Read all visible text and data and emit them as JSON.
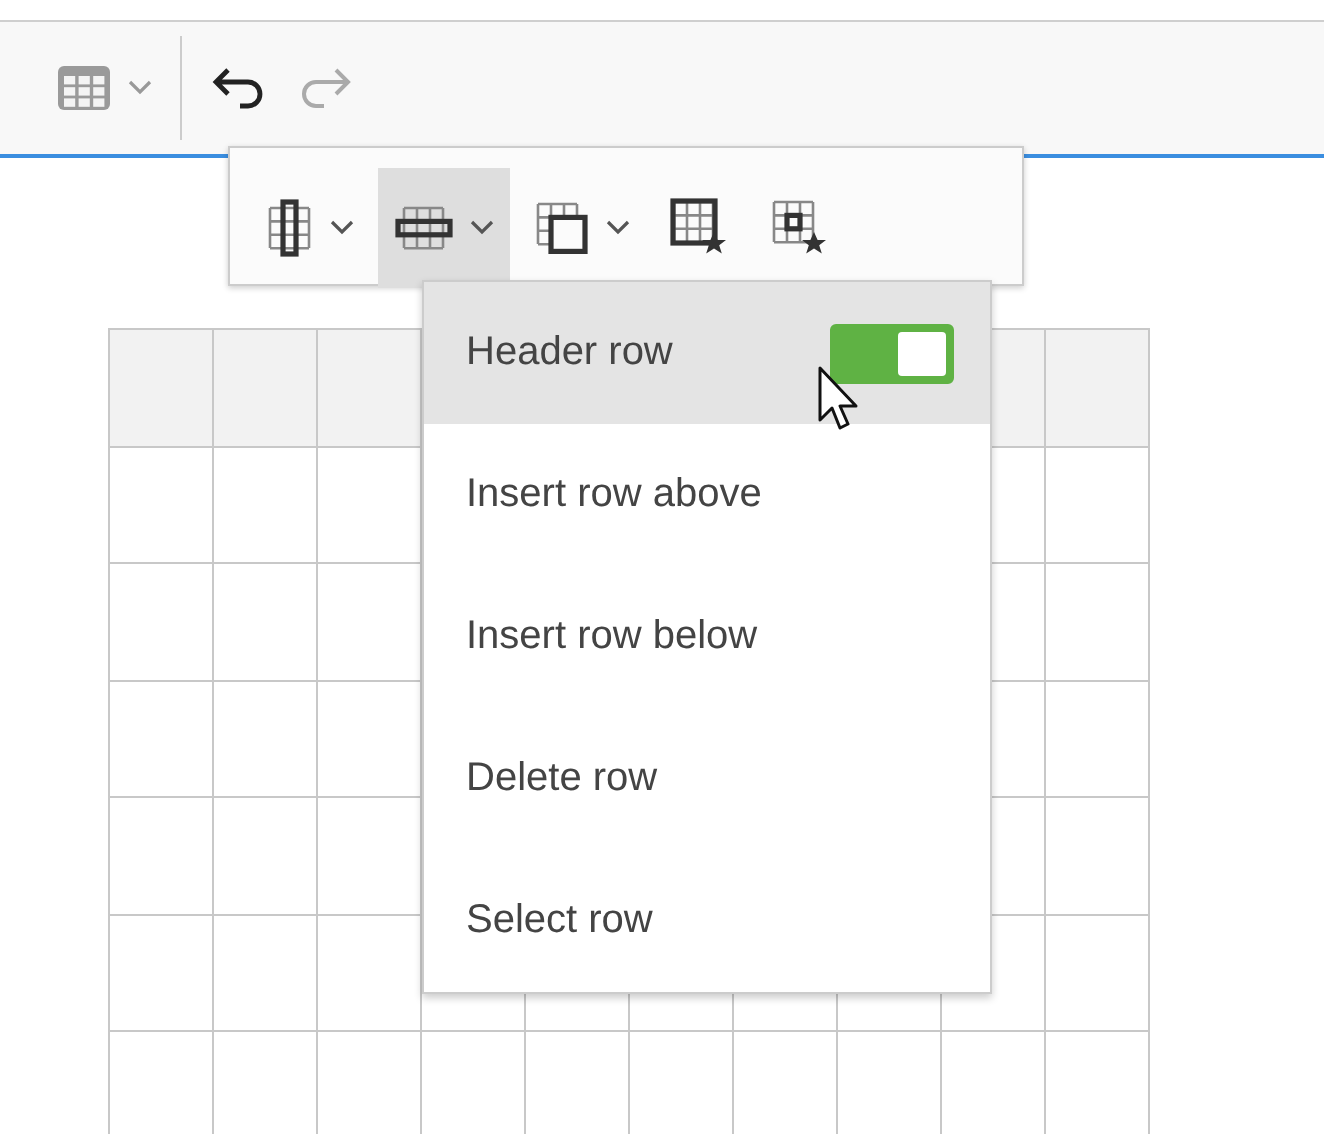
{
  "main_toolbar": {
    "buttons": [
      {
        "kind": "table",
        "has_dropdown": true,
        "disabled": false
      },
      {
        "kind": "undo",
        "has_dropdown": false,
        "disabled": false
      },
      {
        "kind": "redo",
        "has_dropdown": false,
        "disabled": true
      }
    ]
  },
  "table_toolbar": {
    "buttons": [
      {
        "kind": "column",
        "has_dropdown": true,
        "selected": false
      },
      {
        "kind": "row",
        "has_dropdown": true,
        "selected": true
      },
      {
        "kind": "merge",
        "has_dropdown": true,
        "selected": false
      },
      {
        "kind": "table_props",
        "has_dropdown": false,
        "selected": false
      },
      {
        "kind": "cell_props",
        "has_dropdown": false,
        "selected": false
      }
    ]
  },
  "row_menu": {
    "items": [
      {
        "kind": "toggle",
        "label": "Header row",
        "on": true,
        "selected": true
      },
      {
        "kind": "action",
        "label": "Insert row above",
        "selected": false
      },
      {
        "kind": "action",
        "label": "Insert row below",
        "selected": false
      },
      {
        "kind": "action",
        "label": "Delete row",
        "selected": false
      },
      {
        "kind": "action",
        "label": "Select row",
        "selected": false
      }
    ]
  }
}
